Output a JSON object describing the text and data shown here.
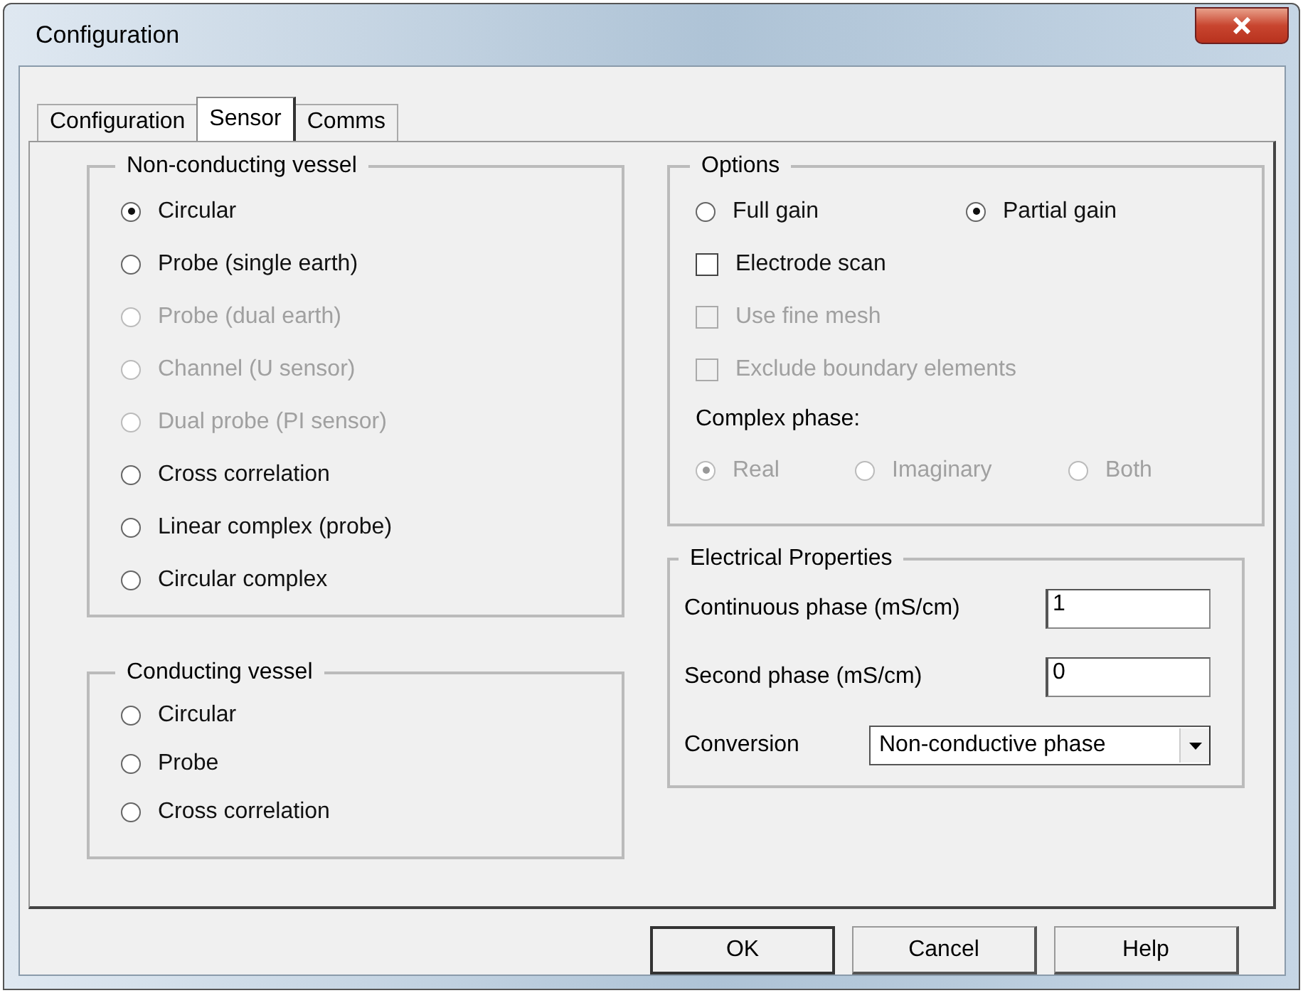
{
  "window": {
    "title": "Configuration"
  },
  "tabs": [
    {
      "label": "Configuration",
      "selected": false
    },
    {
      "label": "Sensor",
      "selected": true
    },
    {
      "label": "Comms",
      "selected": false
    }
  ],
  "non_conducting_vessel": {
    "title": "Non-conducting vessel",
    "options": [
      {
        "label": "Circular",
        "selected": true,
        "disabled": false
      },
      {
        "label": "Probe (single earth)",
        "selected": false,
        "disabled": false
      },
      {
        "label": "Probe (dual earth)",
        "selected": false,
        "disabled": true
      },
      {
        "label": "Channel (U sensor)",
        "selected": false,
        "disabled": true
      },
      {
        "label": "Dual probe (PI sensor)",
        "selected": false,
        "disabled": true
      },
      {
        "label": "Cross correlation",
        "selected": false,
        "disabled": false
      },
      {
        "label": "Linear complex (probe)",
        "selected": false,
        "disabled": false
      },
      {
        "label": "Circular complex",
        "selected": false,
        "disabled": false
      }
    ]
  },
  "conducting_vessel": {
    "title": "Conducting vessel",
    "options": [
      {
        "label": "Circular",
        "selected": false,
        "disabled": false
      },
      {
        "label": "Probe",
        "selected": false,
        "disabled": false
      },
      {
        "label": "Cross correlation",
        "selected": false,
        "disabled": false
      }
    ]
  },
  "options": {
    "title": "Options",
    "gain": [
      {
        "label": "Full gain",
        "selected": false,
        "disabled": false
      },
      {
        "label": "Partial gain",
        "selected": true,
        "disabled": false
      }
    ],
    "checkboxes": [
      {
        "label": "Electrode scan",
        "checked": false,
        "disabled": false
      },
      {
        "label": "Use fine mesh",
        "checked": false,
        "disabled": true
      },
      {
        "label": "Exclude boundary elements",
        "checked": false,
        "disabled": true
      }
    ],
    "complex_phase": {
      "label": "Complex phase:",
      "options": [
        {
          "label": "Real",
          "selected": true,
          "disabled": true
        },
        {
          "label": "Imaginary",
          "selected": false,
          "disabled": true
        },
        {
          "label": "Both",
          "selected": false,
          "disabled": true
        }
      ]
    }
  },
  "electrical_properties": {
    "title": "Electrical Properties",
    "fields": [
      {
        "label": "Continuous phase (mS/cm)",
        "value": "1"
      },
      {
        "label": "Second phase (mS/cm)",
        "value": "0"
      }
    ],
    "conversion": {
      "label": "Conversion",
      "value": "Non-conductive phase"
    }
  },
  "buttons": [
    {
      "label": "OK",
      "default": true
    },
    {
      "label": "Cancel",
      "default": false
    },
    {
      "label": "Help",
      "default": false
    }
  ]
}
